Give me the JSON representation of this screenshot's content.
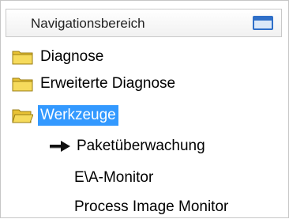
{
  "panel": {
    "title": "Navigationsbereich",
    "header_icon": "window-icon"
  },
  "tree": {
    "items": [
      {
        "label": "Diagnose",
        "icon": "folder-closed-icon",
        "selected": false
      },
      {
        "label": "Erweiterte Diagnose",
        "icon": "folder-closed-icon",
        "selected": false
      },
      {
        "label": "Werkzeuge",
        "icon": "folder-open-icon",
        "selected": true
      }
    ],
    "children": [
      {
        "label": "Paketüberwachung",
        "icon": "arrow-right-icon",
        "current": true
      },
      {
        "label": "E\\A-Monitor",
        "icon": "",
        "current": false
      },
      {
        "label": "Process Image Monitor",
        "icon": "",
        "current": false
      }
    ]
  },
  "colors": {
    "selection": "#3399ff",
    "folder_yellow": "#f3d34a",
    "header_icon_blue": "#2f6fc8"
  }
}
